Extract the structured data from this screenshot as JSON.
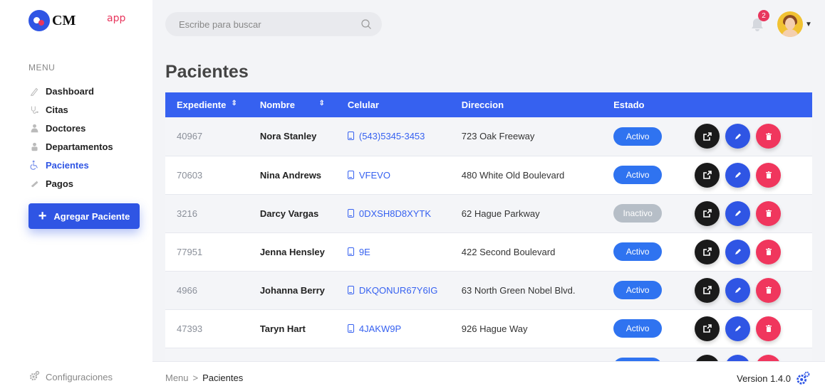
{
  "brand": {
    "logo_text": "CM",
    "suffix": "app"
  },
  "sidebar": {
    "menu_title": "MENU",
    "items": [
      {
        "label": "Dashboard",
        "icon": "pen-icon",
        "active": false
      },
      {
        "label": "Citas",
        "icon": "stethoscope-icon",
        "active": false
      },
      {
        "label": "Doctores",
        "icon": "doctor-icon",
        "active": false
      },
      {
        "label": "Departamentos",
        "icon": "department-icon",
        "active": false
      },
      {
        "label": "Pacientes",
        "icon": "wheelchair-icon",
        "active": true
      },
      {
        "label": "Pagos",
        "icon": "payment-icon",
        "active": false
      }
    ],
    "add_button": "Agregar Paciente",
    "config_label": "Configuraciones"
  },
  "topbar": {
    "search_placeholder": "Escribe para buscar",
    "notifications": "2"
  },
  "page": {
    "title": "Pacientes"
  },
  "table": {
    "headers": [
      "Expediente",
      "Nombre",
      "Celular",
      "Direccion",
      "Estado"
    ],
    "rows": [
      {
        "exp": "40967",
        "nombre": "Nora Stanley",
        "celular": "(543)5345-3453",
        "direccion": "723 Oak Freeway",
        "estado": "Activo"
      },
      {
        "exp": "70603",
        "nombre": "Nina Andrews",
        "celular": "VFEVO",
        "direccion": "480 White Old Boulevard",
        "estado": "Activo"
      },
      {
        "exp": "3216",
        "nombre": "Darcy Vargas",
        "celular": "0DXSH8D8XYTK",
        "direccion": "62 Hague Parkway",
        "estado": "Inactivo"
      },
      {
        "exp": "77951",
        "nombre": "Jenna Hensley",
        "celular": "9E",
        "direccion": "422 Second Boulevard",
        "estado": "Activo"
      },
      {
        "exp": "4966",
        "nombre": "Johanna Berry",
        "celular": "DKQONUR67Y6IG",
        "direccion": "63 North Green Nobel Blvd.",
        "estado": "Activo"
      },
      {
        "exp": "47393",
        "nombre": "Taryn Hart",
        "celular": "4JAKW9P",
        "direccion": "926 Hague Way",
        "estado": "Activo"
      },
      {
        "exp": "",
        "nombre": "",
        "celular": "",
        "direccion": "",
        "estado": "Activo"
      }
    ]
  },
  "footer": {
    "breadcrumb_root": "Menu",
    "breadcrumb_sep": ">",
    "breadcrumb_current": "Pacientes",
    "version": "Version 1.4.0"
  },
  "colors": {
    "primary": "#2f55e4",
    "header": "#3661f0",
    "danger": "#f0365d",
    "inactive": "#b6bec7",
    "notification": "#e8365d"
  }
}
